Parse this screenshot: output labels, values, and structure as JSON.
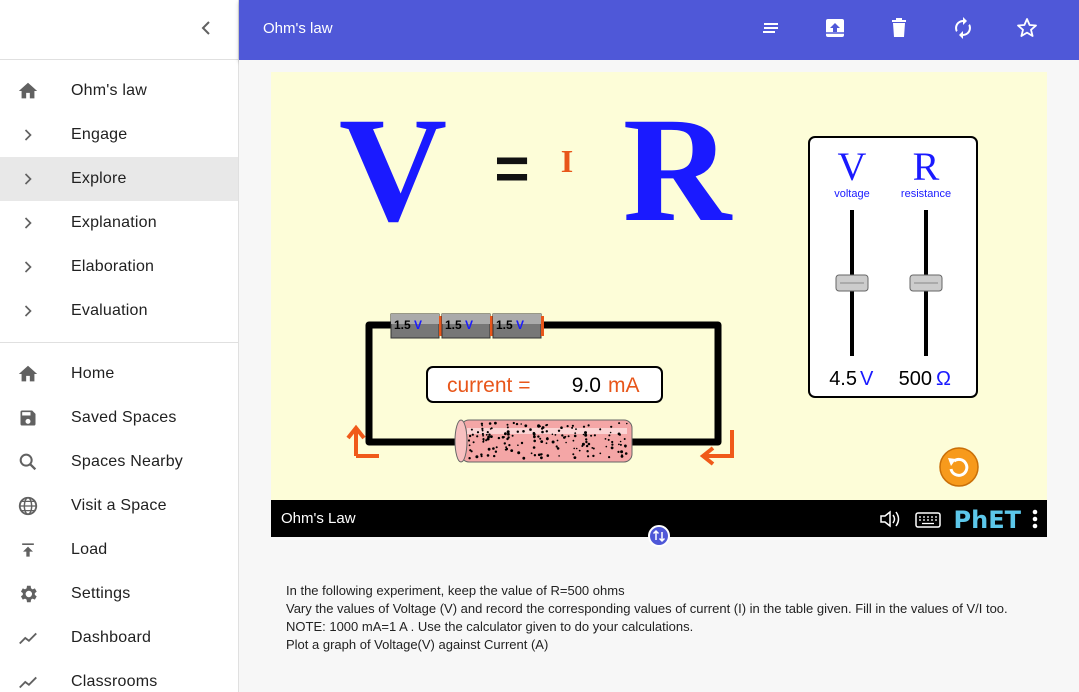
{
  "sidebar": {
    "lesson_items": [
      {
        "label": "Ohm's law",
        "icon": "home-icon"
      },
      {
        "label": "Engage",
        "icon": "chevron-right-icon"
      },
      {
        "label": "Explore",
        "icon": "chevron-right-icon",
        "active": true
      },
      {
        "label": "Explanation",
        "icon": "chevron-right-icon"
      },
      {
        "label": "Elaboration",
        "icon": "chevron-right-icon"
      },
      {
        "label": "Evaluation",
        "icon": "chevron-right-icon"
      }
    ],
    "nav_items": [
      {
        "label": "Home",
        "icon": "home-icon"
      },
      {
        "label": "Saved Spaces",
        "icon": "save-icon"
      },
      {
        "label": "Spaces Nearby",
        "icon": "search-icon"
      },
      {
        "label": "Visit a Space",
        "icon": "globe-icon"
      },
      {
        "label": "Load",
        "icon": "upload-icon"
      },
      {
        "label": "Settings",
        "icon": "gear-icon"
      },
      {
        "label": "Dashboard",
        "icon": "trend-icon"
      },
      {
        "label": "Classrooms",
        "icon": "trend-icon"
      }
    ]
  },
  "topbar": {
    "title": "Ohm's law",
    "actions": [
      "notes-icon",
      "archive-upload-icon",
      "trash-icon",
      "sync-icon",
      "star-icon"
    ]
  },
  "sim": {
    "equation": {
      "v": "V",
      "equals": "=",
      "i": "I",
      "r": "R"
    },
    "batteries": [
      "1.5",
      "1.5",
      "1.5"
    ],
    "battery_unit": "V",
    "current_label": "current =",
    "current_value": "9.0",
    "current_unit": "mA",
    "sliders": {
      "voltage": {
        "symbol": "V",
        "label": "voltage",
        "value": "4.5",
        "unit": "V",
        "level": 0.5
      },
      "resistance": {
        "symbol": "R",
        "label": "resistance",
        "value": "500",
        "unit": "Ω",
        "level": 0.5
      }
    },
    "title": "Ohm's Law",
    "brand": "PhET"
  },
  "instructions": [
    "In the following experiment, keep the value of R=500 ohms",
    "Vary the values of Voltage (V) and record the corresponding values of current (I) in the table given. Fill in the values of V/I too.",
    "NOTE: 1000 mA=1 A . Use the calculator given to do your calculations.",
    "Plot a graph of Voltage(V) against Current (A)"
  ],
  "colors": {
    "accent": "#4f58d8",
    "sim_bg": "#fdfdd8",
    "equation_blue": "#1a1aff",
    "current_orange": "#e8561a"
  }
}
